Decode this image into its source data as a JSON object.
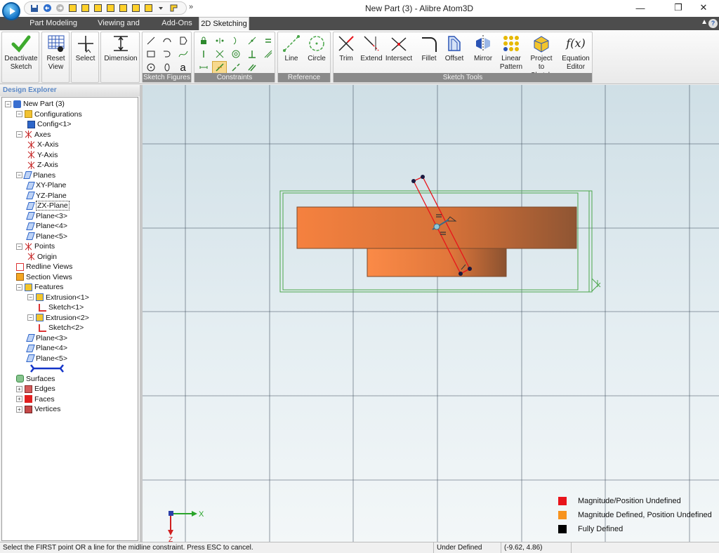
{
  "window": {
    "title": "New Part (3) - Alibre Atom3D",
    "minimize": "—",
    "restore": "❐",
    "close": "✕"
  },
  "quick_access": {
    "more": "»"
  },
  "tabs": [
    {
      "label": "Part Modeling"
    },
    {
      "label": "Viewing and Analysis"
    },
    {
      "label": "Add-Ons"
    },
    {
      "label": "2D Sketching",
      "active": true
    }
  ],
  "ribbon": {
    "collapse": "▲",
    "help": "?",
    "deactivate": {
      "line1": "Deactivate",
      "line2": "Sketch"
    },
    "reset_view": {
      "line1": "Reset",
      "line2": "View"
    },
    "select": {
      "label": "Select"
    },
    "dimension": {
      "label": "Dimension"
    },
    "sketch_figures_label": "Sketch Figures",
    "constraints_label": "Constraints",
    "reference_label": "Reference",
    "sketch_tools_label": "Sketch Tools",
    "text_tool_glyph": "a",
    "line": {
      "label": "Line"
    },
    "circle": {
      "label": "Circle"
    },
    "trim": {
      "label": "Trim"
    },
    "extend": {
      "label": "Extend"
    },
    "intersect": {
      "label": "Intersect"
    },
    "fillet": {
      "label": "Fillet"
    },
    "offset": {
      "label": "Offset"
    },
    "mirror": {
      "label": "Mirror"
    },
    "linear_pattern": {
      "line1": "Linear",
      "line2": "Pattern ▾"
    },
    "project": {
      "line1": "Project",
      "line2": "to Sketch"
    },
    "equation": {
      "glyph": "f(x)",
      "line1": "Equation",
      "line2": "Editor"
    }
  },
  "explorer": {
    "header": "Design Explorer",
    "items": [
      {
        "label": "New Part (3)",
        "icon": "part-icon"
      },
      {
        "label": "Configurations",
        "icon": "folder-icon"
      },
      {
        "label": "Config<1>",
        "icon": "config-icon"
      },
      {
        "label": "Axes",
        "icon": "axes-icon"
      },
      {
        "label": "X-Axis",
        "icon": "axis-icon"
      },
      {
        "label": "Y-Axis",
        "icon": "axis-icon"
      },
      {
        "label": "Z-Axis",
        "icon": "axis-icon"
      },
      {
        "label": "Planes",
        "icon": "plane-icon"
      },
      {
        "label": "XY-Plane",
        "icon": "plane-icon"
      },
      {
        "label": "YZ-Plane",
        "icon": "plane-icon"
      },
      {
        "label": "ZX-Plane",
        "icon": "plane-icon"
      },
      {
        "label": "Plane<3>",
        "icon": "plane-icon"
      },
      {
        "label": "Plane<4>",
        "icon": "plane-icon"
      },
      {
        "label": "Plane<5>",
        "icon": "plane-icon"
      },
      {
        "label": "Points",
        "icon": "points-icon"
      },
      {
        "label": "Origin",
        "icon": "origin-icon"
      },
      {
        "label": "Redline Views",
        "icon": "redline-icon"
      },
      {
        "label": "Section Views",
        "icon": "section-icon"
      },
      {
        "label": "Features",
        "icon": "feature-icon"
      },
      {
        "label": "Extrusion<1>",
        "icon": "extrusion-icon"
      },
      {
        "label": "Sketch<1>",
        "icon": "sketch-icon"
      },
      {
        "label": "Extrusion<2>",
        "icon": "extrusion-icon"
      },
      {
        "label": "Sketch<2>",
        "icon": "sketch-icon"
      },
      {
        "label": "Plane<3>",
        "icon": "plane-icon"
      },
      {
        "label": "Plane<4>",
        "icon": "plane-icon"
      },
      {
        "label": "Plane<5>",
        "icon": "plane-icon"
      },
      {
        "label": "",
        "icon": "rollback-bar-icon"
      },
      {
        "label": "Surfaces",
        "icon": "surfaces-icon"
      },
      {
        "label": "Edges",
        "icon": "edges-icon"
      },
      {
        "label": "Faces",
        "icon": "faces-icon"
      },
      {
        "label": "Vertices",
        "icon": "vertices-icon"
      }
    ]
  },
  "legend": [
    {
      "label": "Magnitude/Position Undefined",
      "color": "#e8141b"
    },
    {
      "label": "Magnitude Defined, Position Undefined",
      "color": "#f7931e"
    },
    {
      "label": "Fully Defined",
      "color": "#000000"
    }
  ],
  "triad": {
    "x_label": "X",
    "z_label": "Z"
  },
  "colors": {
    "grid": "#3e4c5c",
    "sketch_green": "#4aa64a",
    "extrusion_orange": "#f7874a",
    "extrusion_dark": "#9b5a34",
    "constraint_line": "#e8141b"
  },
  "status": {
    "message": "Select the FIRST point OR a line for the midline constraint. Press ESC to cancel.",
    "state": "Under Defined",
    "coords": "(-9.62, 4.86)"
  }
}
